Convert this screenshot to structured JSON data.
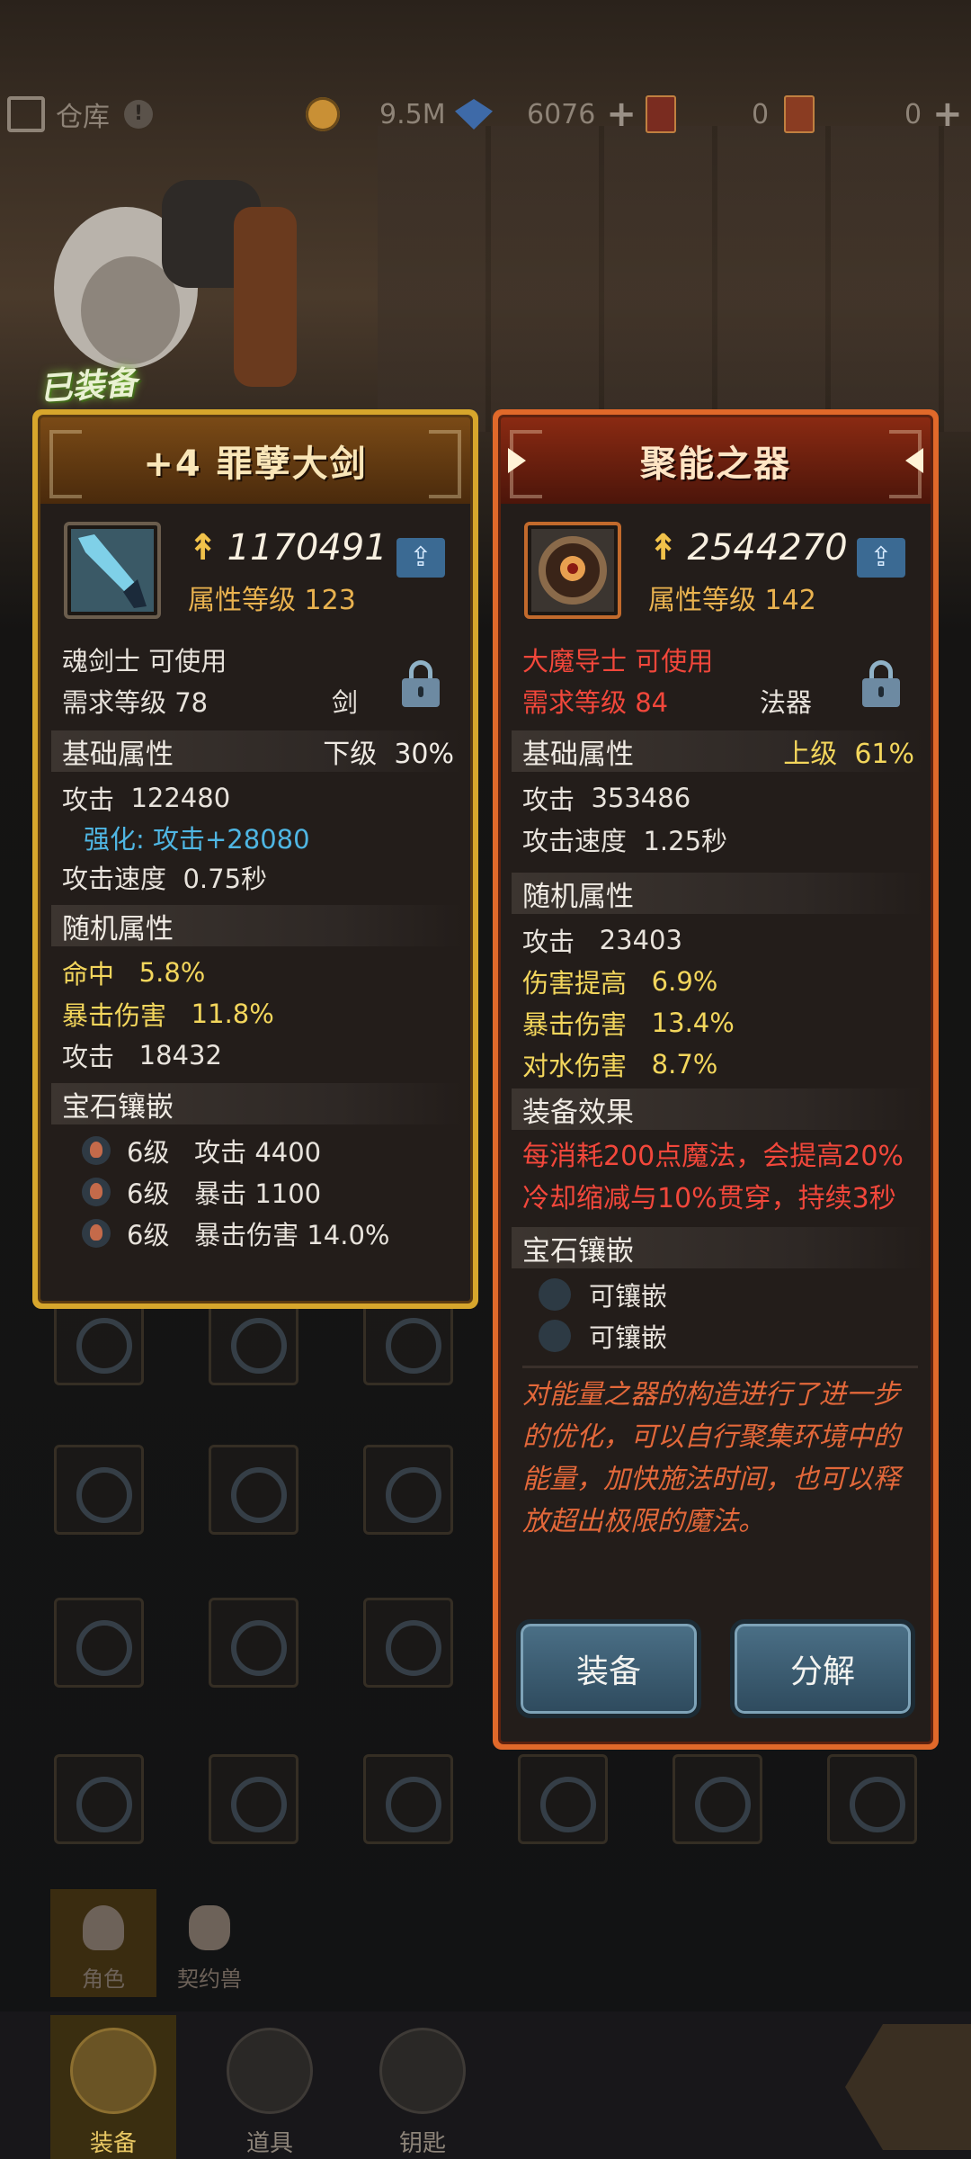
{
  "topbar": {
    "warehouse_label": "仓库",
    "coins": "9.5M",
    "gems": "6076",
    "card_red": "0",
    "card_gold": "0"
  },
  "equipped_tag": "已装备",
  "left": {
    "title": "+4 罪孽大剑",
    "power": "1170491",
    "attr_level": "属性等级 123",
    "usable_by": "魂剑士 可使用",
    "req_level": "需求等级 78",
    "type": "剑",
    "base_section": "基础属性",
    "base_grade": "下级",
    "base_pct": "30%",
    "base_stats": [
      {
        "label": "攻击",
        "value": "122480"
      },
      {
        "label": "强化: 攻击+28080",
        "value": ""
      },
      {
        "label": "攻击速度",
        "value": "0.75秒"
      }
    ],
    "random_section": "随机属性",
    "random_stats": [
      {
        "label": "命中",
        "value": "5.8%"
      },
      {
        "label": "暴击伤害",
        "value": "11.8%"
      },
      {
        "label": "攻击",
        "value": "18432"
      }
    ],
    "gem_section": "宝石镶嵌",
    "gems": [
      {
        "level": "6级",
        "text": "攻击 4400"
      },
      {
        "level": "6级",
        "text": "暴击 1100"
      },
      {
        "level": "6级",
        "text": "暴击伤害 14.0%"
      }
    ]
  },
  "right": {
    "title": "聚能之器",
    "power": "2544270",
    "attr_level": "属性等级 142",
    "usable_by": "大魔导士 可使用",
    "req_level": "需求等级 84",
    "type": "法器",
    "base_section": "基础属性",
    "base_grade": "上级",
    "base_pct": "61%",
    "base_stats": [
      {
        "label": "攻击",
        "value": "353486"
      },
      {
        "label": "攻击速度",
        "value": "1.25秒"
      }
    ],
    "random_section": "随机属性",
    "random_stats": [
      {
        "label": "攻击",
        "value": "23403"
      },
      {
        "label": "伤害提高",
        "value": "6.9%"
      },
      {
        "label": "暴击伤害",
        "value": "13.4%"
      },
      {
        "label": "对水伤害",
        "value": "8.7%"
      }
    ],
    "effect_section": "装备效果",
    "effect_text": "每消耗200点魔法，会提高20%冷却缩减与10%贯穿，持续3秒",
    "gem_section": "宝石镶嵌",
    "gem_slots": [
      "可镶嵌",
      "可镶嵌"
    ],
    "lore": "对能量之器的构造进行了进一步的优化，可以自行聚集环境中的能量，加快施法时间，也可以释放超出极限的魔法。",
    "equip_button": "装备",
    "dismantle_button": "分解"
  },
  "subtabs": [
    "角色",
    "契约兽"
  ],
  "bottom_nav": [
    "装备",
    "道具",
    "钥匙"
  ]
}
